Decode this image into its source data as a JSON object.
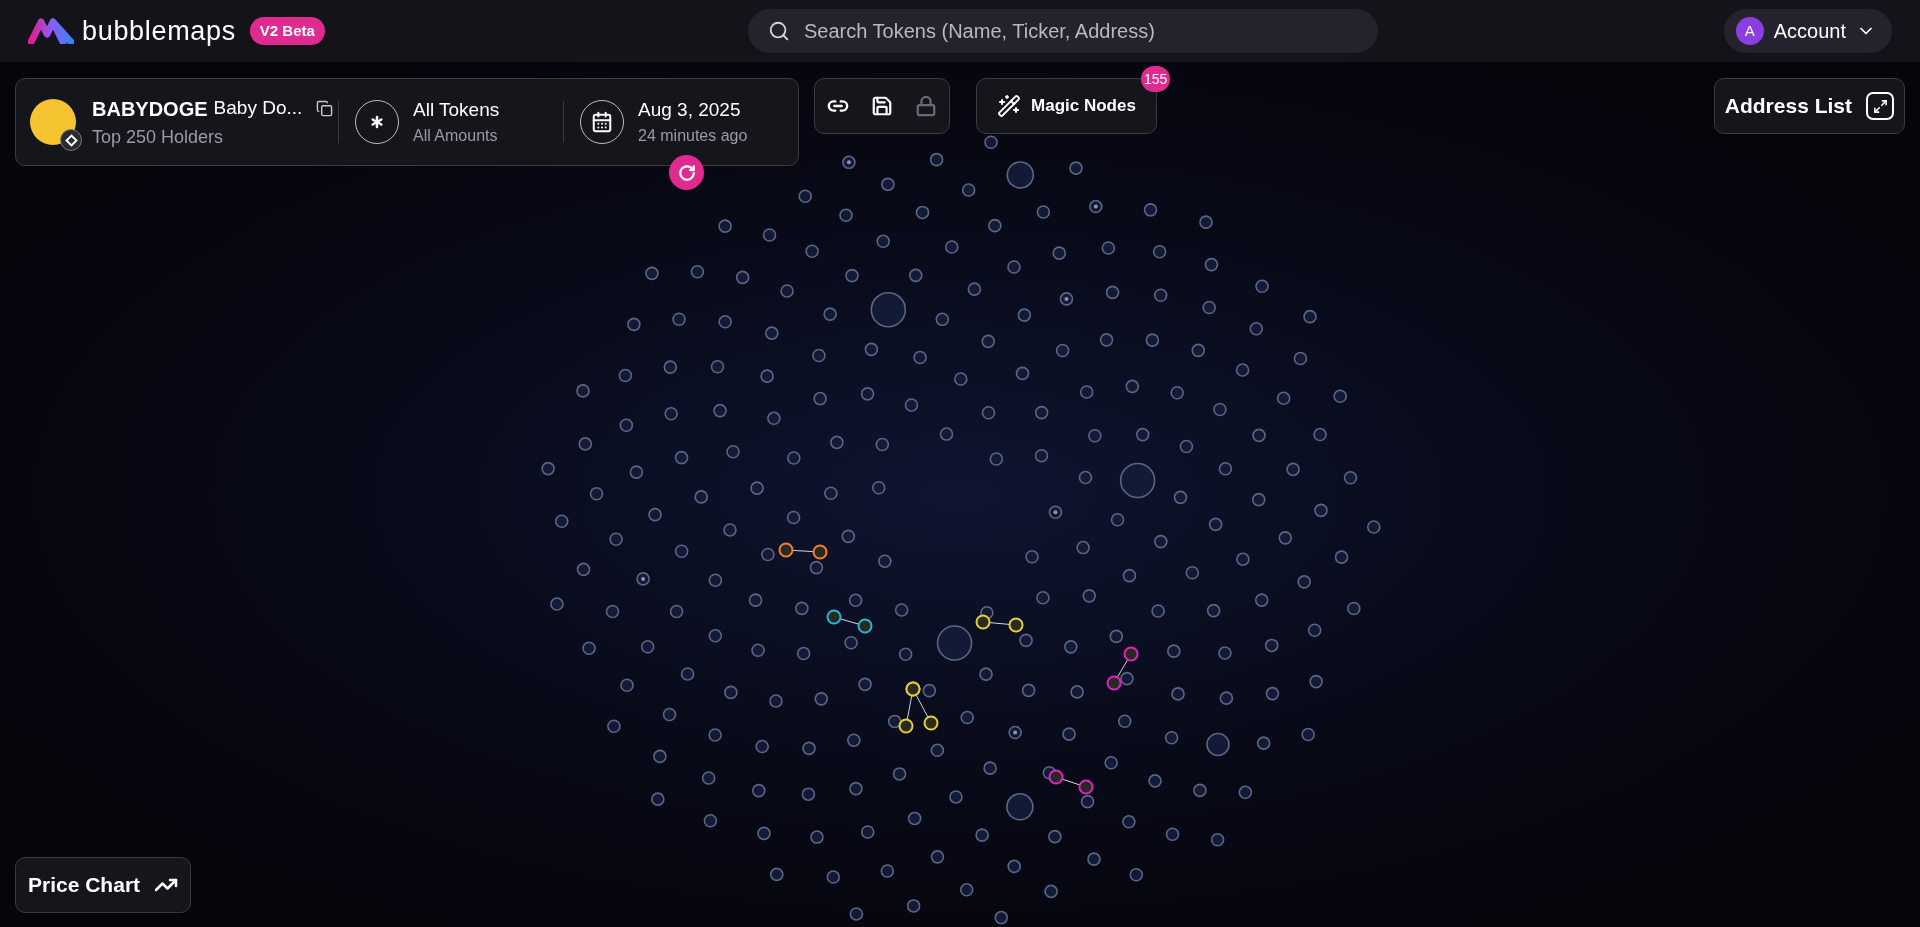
{
  "header": {
    "logo": "bubblemaps",
    "badge": "V2 Beta",
    "search": {
      "placeholder": "Search Tokens (Name, Ticker, Address)"
    },
    "account": {
      "avatar": "A",
      "label": "Account"
    }
  },
  "token_panel": {
    "ticker": "BABYDOGE",
    "name": "Baby Do...",
    "subtitle": "Top 250 Holders",
    "filter": {
      "title": "All Tokens",
      "subtitle": "All Amounts"
    },
    "date": {
      "title": "Aug 3, 2025",
      "subtitle": "24 minutes ago"
    }
  },
  "toolbar": {
    "tools": [
      {
        "kind": "link",
        "disabled": false
      },
      {
        "kind": "save",
        "disabled": false
      },
      {
        "kind": "lock",
        "disabled": true
      }
    ],
    "magic_nodes": {
      "label": "Magic Nodes",
      "count": "155"
    }
  },
  "address_list": {
    "label": "Address List"
  },
  "price_chart": {
    "label": "Price Chart"
  }
}
